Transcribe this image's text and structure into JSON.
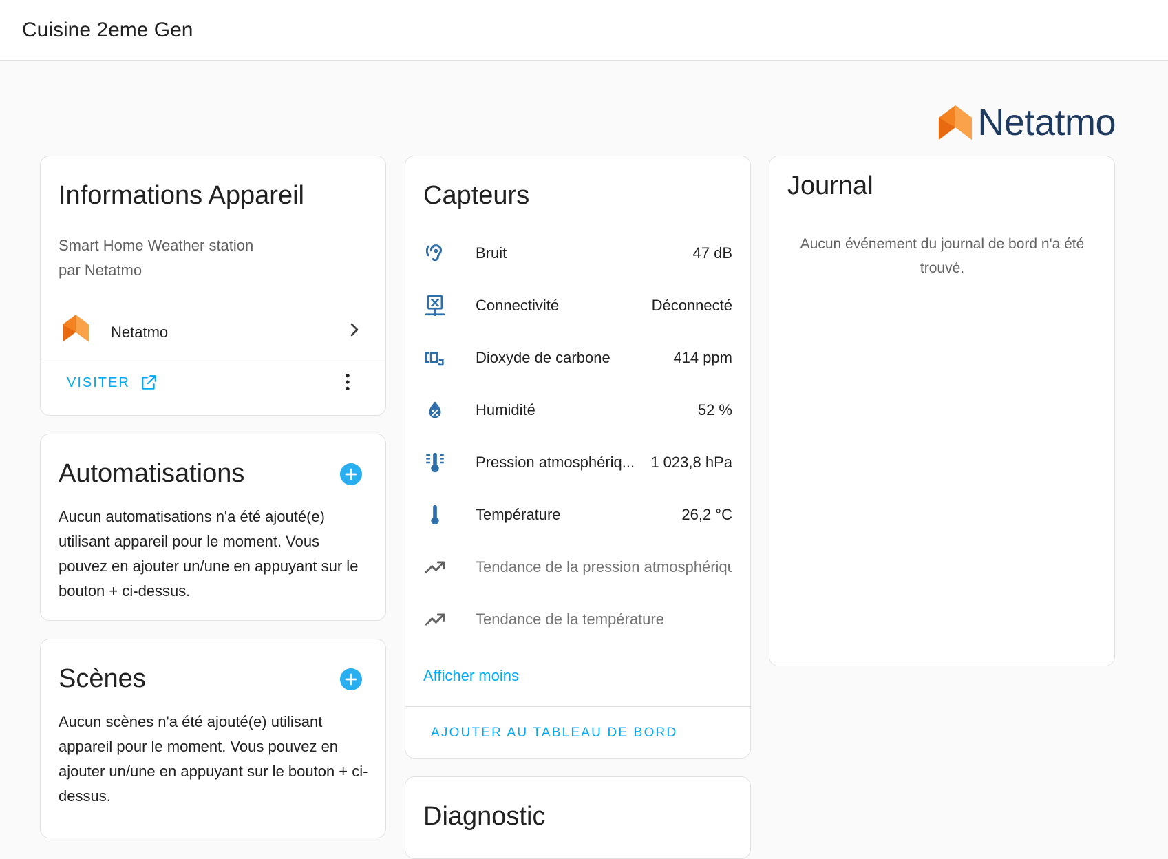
{
  "header": {
    "title": "Cuisine 2eme Gen"
  },
  "brand": {
    "name": "Netatmo",
    "accent": "#f58220"
  },
  "device_info": {
    "title": "Informations Appareil",
    "model": "Smart Home Weather station",
    "manufacturer": "par Netatmo",
    "integration": "Netatmo",
    "visit_label": "VISITER"
  },
  "automations": {
    "title": "Automatisations",
    "empty": "Aucun automatisations n'a été ajouté(e) utilisant appareil pour le moment. Vous pouvez en ajouter un/une en appuyant sur le bouton + ci-dessus."
  },
  "scenes": {
    "title": "Scènes",
    "empty": "Aucun scènes n'a été ajouté(e) utilisant appareil pour le moment. Vous pouvez en ajouter un/une en appuyant sur le bouton + ci-dessus."
  },
  "sensors": {
    "title": "Capteurs",
    "items": [
      {
        "label": "Bruit",
        "value": "47 dB",
        "icon": "ear-icon"
      },
      {
        "label": "Connectivité",
        "value": "Déconnecté",
        "icon": "network-off-icon"
      },
      {
        "label": "Dioxyde de carbone",
        "value": "414 ppm",
        "icon": "co2-icon"
      },
      {
        "label": "Humidité",
        "value": "52 %",
        "icon": "water-percent-icon"
      },
      {
        "label": "Pression atmosphériq...",
        "value": "1 023,8 hPa",
        "icon": "thermometer-lines-icon"
      },
      {
        "label": "Température",
        "value": "26,2 °C",
        "icon": "thermometer-icon"
      },
      {
        "label": "Tendance de la pression atmosphérique",
        "value": "",
        "icon": "trending-up-icon"
      },
      {
        "label": "Tendance de la température",
        "value": "",
        "icon": "trending-up-icon"
      }
    ],
    "show_less": "Afficher moins",
    "add_dashboard": "AJOUTER AU TABLEAU DE BORD"
  },
  "diagnostic": {
    "title": "Diagnostic"
  },
  "journal": {
    "title": "Journal",
    "empty": "Aucun événement du journal de bord n'a été trouvé."
  }
}
